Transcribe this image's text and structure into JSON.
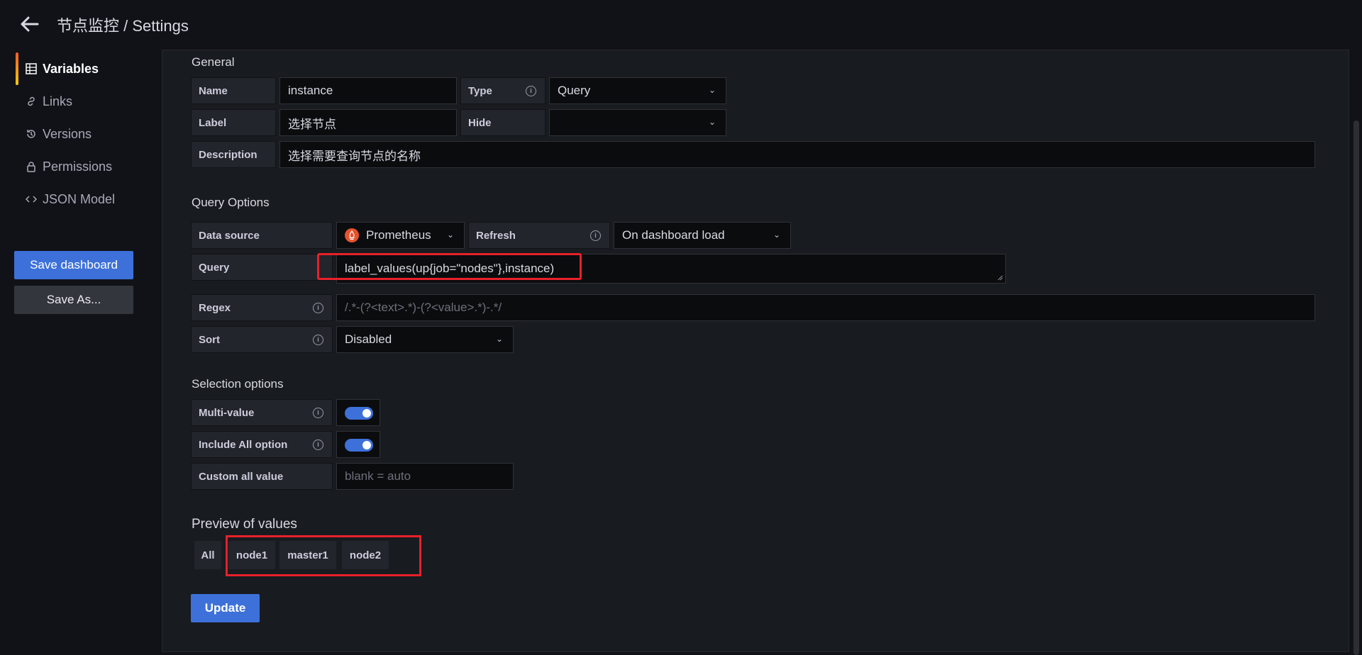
{
  "header": {
    "title": "节点监控 / Settings"
  },
  "sidebar": {
    "items": [
      {
        "label": "Variables",
        "icon": "grid-icon"
      },
      {
        "label": "Links",
        "icon": "link-icon"
      },
      {
        "label": "Versions",
        "icon": "history-icon"
      },
      {
        "label": "Permissions",
        "icon": "lock-icon"
      },
      {
        "label": "JSON Model",
        "icon": "code-icon"
      }
    ],
    "save_dashboard": "Save dashboard",
    "save_as": "Save As..."
  },
  "general": {
    "title": "General",
    "name_label": "Name",
    "name_value": "instance",
    "type_label": "Type",
    "type_value": "Query",
    "label_label": "Label",
    "label_value": "选择节点",
    "hide_label": "Hide",
    "hide_value": "",
    "description_label": "Description",
    "description_value": "选择需要查询节点的名称"
  },
  "query_options": {
    "title": "Query Options",
    "datasource_label": "Data source",
    "datasource_value": "Prometheus",
    "refresh_label": "Refresh",
    "refresh_value": "On dashboard load",
    "query_label": "Query",
    "query_value": "label_values(up{job=\"nodes\"},instance)",
    "regex_label": "Regex",
    "regex_placeholder": "/.*-(?<text>.*)-(?<value>.*)-.*/",
    "sort_label": "Sort",
    "sort_value": "Disabled"
  },
  "selection_options": {
    "title": "Selection options",
    "multi_value_label": "Multi-value",
    "multi_value_on": true,
    "include_all_label": "Include All option",
    "include_all_on": true,
    "custom_all_label": "Custom all value",
    "custom_all_placeholder": "blank = auto"
  },
  "preview": {
    "title": "Preview of values",
    "values": [
      "All",
      "node1",
      "master1",
      "node2"
    ]
  },
  "update_label": "Update",
  "colors": {
    "primary": "#3d71d9",
    "highlight": "#e8202a",
    "prometheus": "#e6522c"
  }
}
